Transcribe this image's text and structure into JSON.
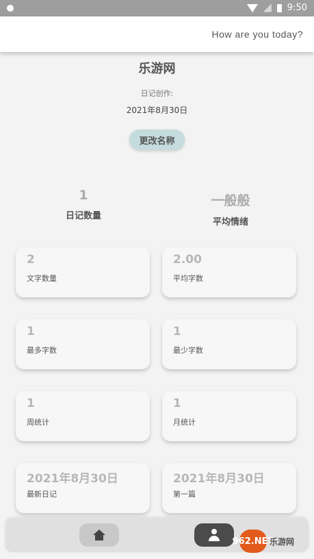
{
  "status_bar": {
    "time": "9:50"
  },
  "header": {
    "greeting": "How are you today?"
  },
  "diary": {
    "name": "乐游网",
    "created_label": "日记创作:",
    "created_date": "2021年8月30日",
    "rename_label": "更改名称"
  },
  "summary": [
    {
      "value": "1",
      "label": "日记数量"
    },
    {
      "value": "一般般",
      "label": "平均情绪"
    }
  ],
  "stats": [
    {
      "value": "2",
      "label": "文字数量"
    },
    {
      "value": "2.00",
      "label": "平均字数"
    },
    {
      "value": "1",
      "label": "最多字数"
    },
    {
      "value": "1",
      "label": "最少字数"
    },
    {
      "value": "1",
      "label": "周统计"
    },
    {
      "value": "1",
      "label": "月统计"
    },
    {
      "value": "2021年8月30日",
      "label": "最新日记"
    },
    {
      "value": "2021年8月30日",
      "label": "第一篇"
    }
  ],
  "nav": {
    "home_icon": "home-icon",
    "profile_icon": "user-icon"
  },
  "watermark": {
    "logo_text": "962.NET",
    "brand": "乐游网"
  }
}
